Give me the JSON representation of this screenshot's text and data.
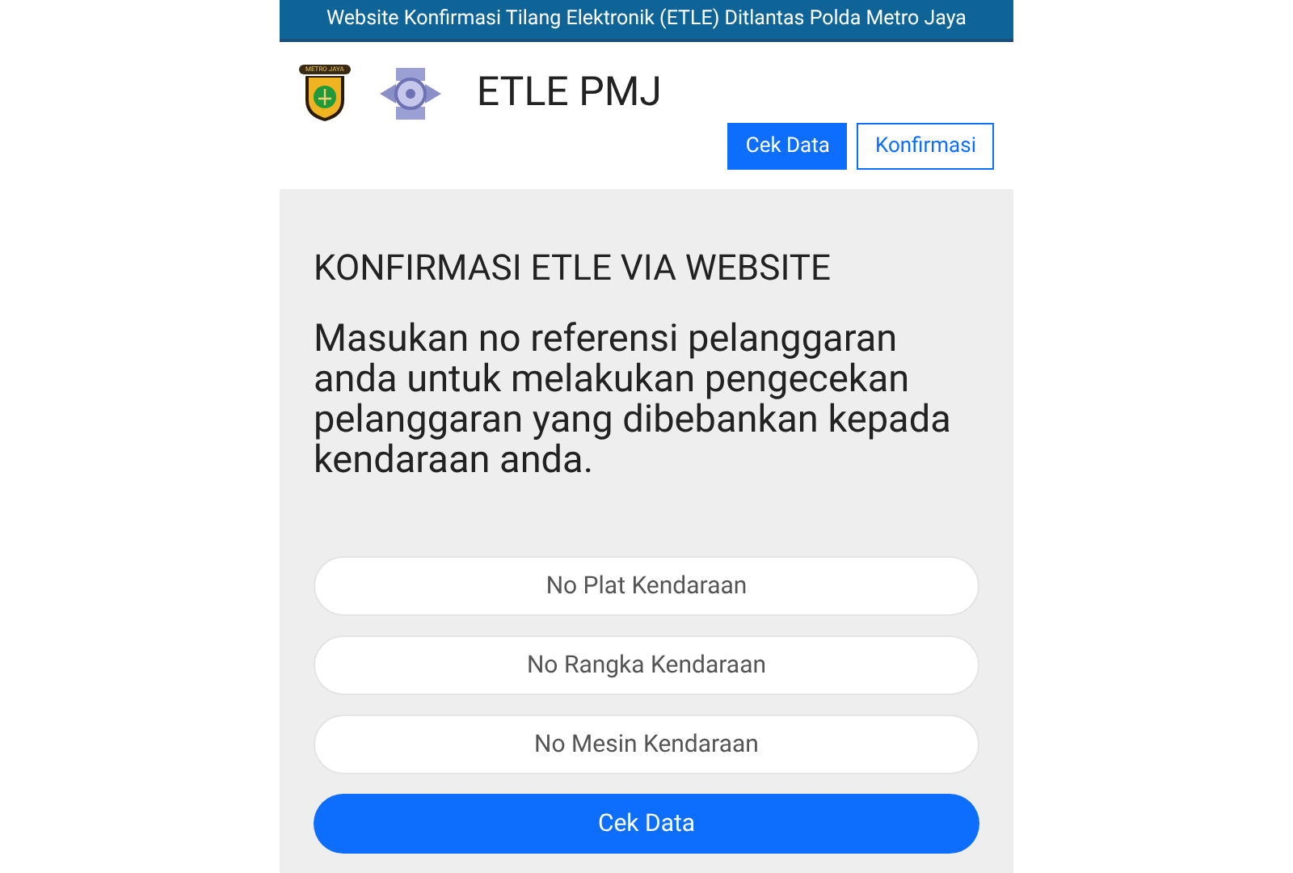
{
  "banner": "Website Konfirmasi Tilang Elektronik (ETLE) Ditlantas Polda Metro Jaya",
  "brand": {
    "logo_text": "METRO JAYA",
    "title": "ETLE PMJ"
  },
  "nav": [
    {
      "label": "Cek Data",
      "selected": true
    },
    {
      "label": "Konfirmasi",
      "selected": false
    }
  ],
  "panel": {
    "heading": "KONFIRMASI ETLE VIA WEBSITE",
    "description": "Masukan no referensi pelanggaran anda untuk melakukan pengecekan pelanggaran yang dibebankan kepada kendaraan anda.",
    "fields": [
      {
        "placeholder": "No Plat Kendaraan"
      },
      {
        "placeholder": "No Rangka Kendaraan"
      },
      {
        "placeholder": "No Mesin Kendaraan"
      }
    ],
    "submit": "Cek Data"
  }
}
